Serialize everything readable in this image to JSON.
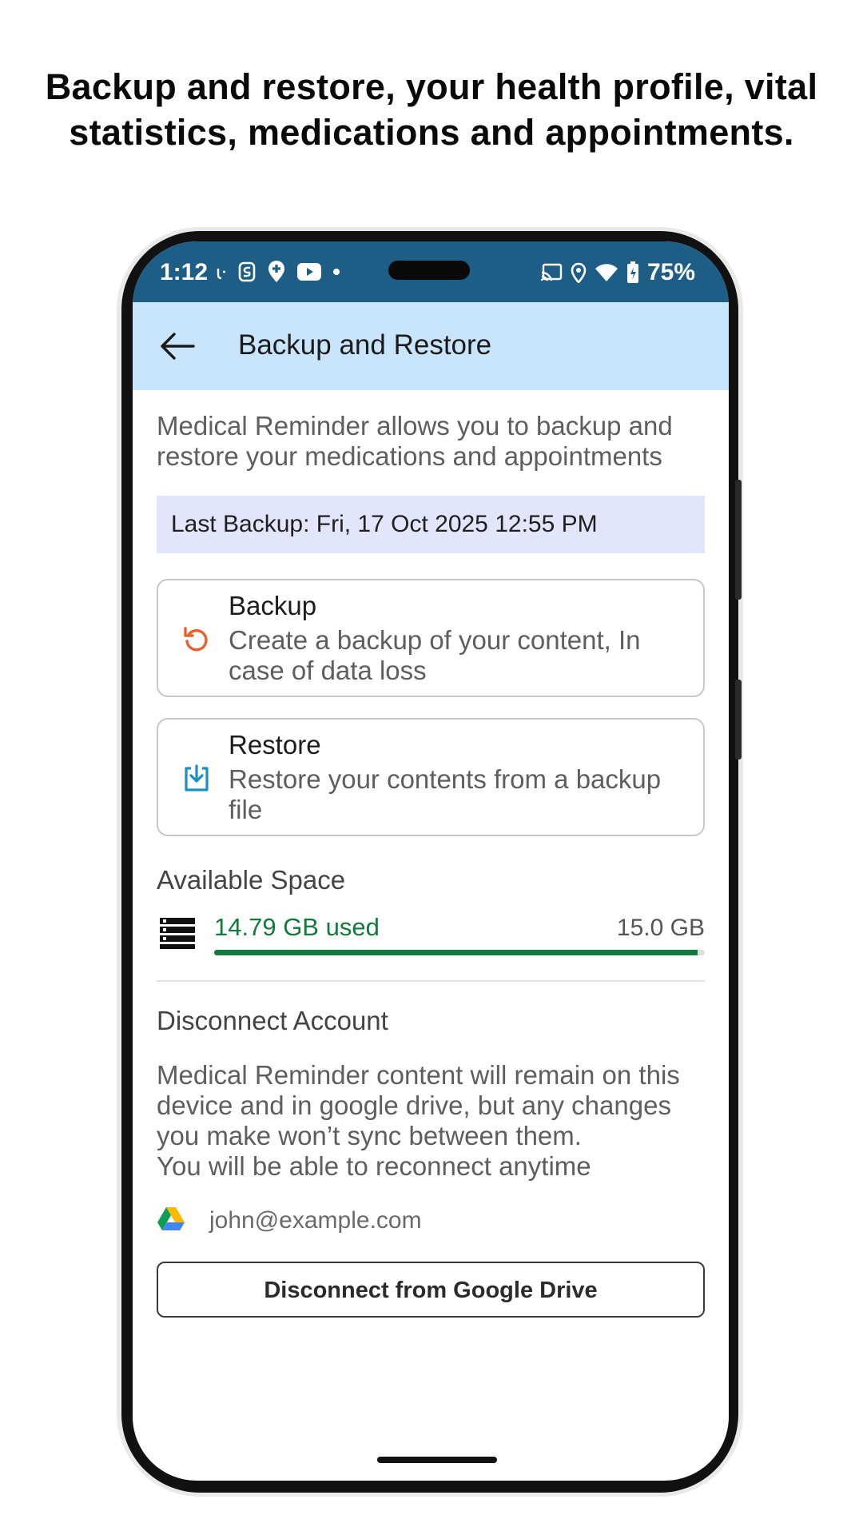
{
  "headline": {
    "line1": "Backup and restore, your health profile, vital",
    "line2": "statistics, medications and appointments."
  },
  "status_bar": {
    "time": "1:12",
    "battery": "75%",
    "left_icons": [
      "notification-icon",
      "s-app-icon",
      "location-plus-icon",
      "youtube-icon",
      "dot-icon"
    ],
    "right_icons": [
      "cast-icon",
      "location-icon",
      "wifi-icon",
      "battery-icon"
    ]
  },
  "app_bar": {
    "title": "Backup and Restore"
  },
  "intro": "Medical Reminder allows you to backup and restore your medications and appointments",
  "last_backup": "Last Backup: Fri, 17 Oct 2025  12:55 PM",
  "cards": {
    "backup": {
      "title": "Backup",
      "subtitle": "Create a backup of your content, In case of data loss",
      "icon": "refresh-icon",
      "icon_color": "#e8612c"
    },
    "restore": {
      "title": "Restore",
      "subtitle": "Restore your contents from a backup file",
      "icon": "download-icon",
      "icon_color": "#1a8fc4"
    }
  },
  "available_space": {
    "title": "Available Space",
    "used": "14.79 GB used",
    "total": "15.0 GB",
    "used_fraction": 0.986,
    "bar_color": "#127a3c"
  },
  "disconnect": {
    "title": "Disconnect Account",
    "text": "Medical Reminder content will remain on this device and in google drive, but any changes you make won’t sync between them.\nYou will be able to reconnect anytime",
    "email": "john@example.com",
    "button": "Disconnect from Google Drive"
  },
  "colors": {
    "status_bar": "#1e5e86",
    "app_bar": "#c9e5fc",
    "last_backup_bg": "#e3e5fc"
  }
}
